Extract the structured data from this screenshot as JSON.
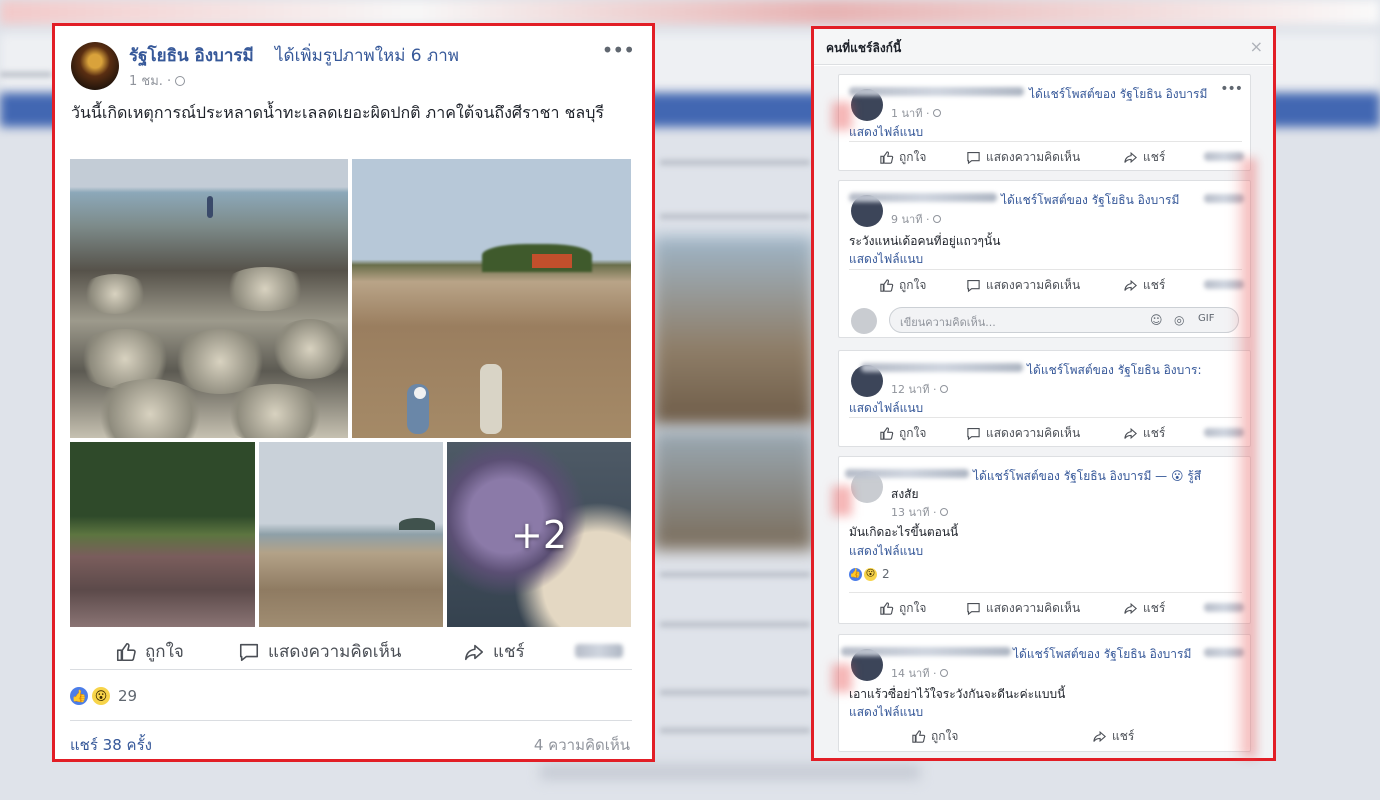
{
  "post": {
    "author": "รัฐโยธิน อิงบารมี",
    "action": "ได้เพิ่มรูปภาพใหม่ 6 ภาพ",
    "time": "1 ชม. · ",
    "more": "•••",
    "text": "วันนี้เกิดเหตุการณ์ประหลาดน้ำทะเลลดเยอะผิดปกติ ภาคใต้จนถึงศีราชา ชลบุรี",
    "photos_more": "+2",
    "like_label": "ถูกใจ",
    "comment_label": "แสดงความคิดเห็น",
    "share_label": "แชร์",
    "reaction_count": "29",
    "shares_text": "แชร์ 38 ครั้ง",
    "comments_text": "4 ความคิดเห็น"
  },
  "dialog": {
    "title": "คนที่แชร์ลิงก์นี้",
    "close": "×",
    "like_label": "ถูกใจ",
    "comment_label": "แสดงความคิดเห็น",
    "share_label": "แชร์",
    "attachment_label": "แสดงไฟล์แนบ",
    "items": [
      {
        "head": "ได้แชร์โพสต์ของ รัฐโยธิน อิงบารมี",
        "time": "1 นาที · ",
        "text": "",
        "more": "•••"
      },
      {
        "head": "ได้แชร์โพสต์ของ รัฐโยธิน อิงบารมี",
        "time": "9 นาที · ",
        "text": "ระวังแหน่เด้อคนที่อยู่แถวๆนั้น",
        "comment_placeholder": "เขียนความคิดเห็น..."
      },
      {
        "head": "ได้แชร์โพสต์ของ รัฐโยธิน อิงบาร:",
        "time": "12 นาที · ",
        "text": ""
      },
      {
        "head": "ได้แชร์โพสต์ของ รัฐโยธิน อิงบารมี — 😮 รู้สึ",
        "subhead": "สงสัย",
        "time": "13 นาที · ",
        "text": "มันเกิดอะไรขึ้นตอนนี้",
        "reactions": "2"
      },
      {
        "head": "ได้แชร์โพสต์ของ รัฐโยธิน อิงบารมี",
        "time": "14 นาที · ",
        "text": "เอาแร้วซื่อย่าไว้ใจระวังกันจะดีนะค่ะแบบนี้"
      }
    ]
  }
}
